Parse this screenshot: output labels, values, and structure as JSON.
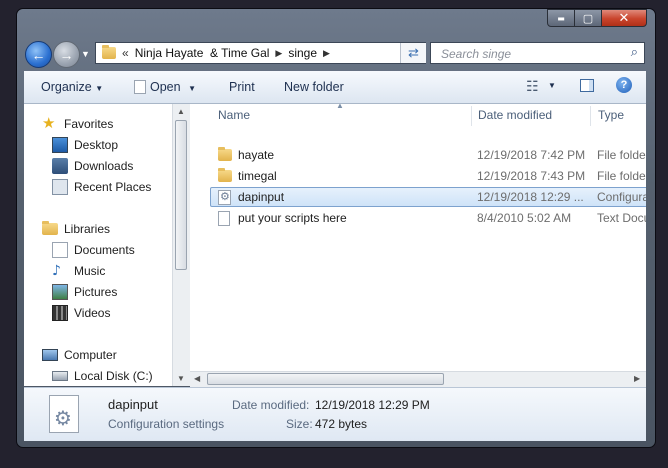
{
  "window": {
    "caption_buttons": {
      "minimize": "▬",
      "maximize": "▢",
      "close": "✕"
    }
  },
  "address": {
    "overflow": "«",
    "segments": [
      "Ninja Hayate  & Time Gal",
      "singe"
    ],
    "refresh_icon": "refresh-icon"
  },
  "search": {
    "placeholder": "Search singe"
  },
  "toolbar": {
    "organize": "Organize",
    "open": "Open",
    "print": "Print",
    "new_folder": "New folder"
  },
  "nav_pane": {
    "groups": [
      {
        "label": "Favorites",
        "icon": "star-icon",
        "items": [
          {
            "label": "Desktop",
            "icon": "desktop-icon"
          },
          {
            "label": "Downloads",
            "icon": "downloads-icon"
          },
          {
            "label": "Recent Places",
            "icon": "recent-places-icon"
          }
        ]
      },
      {
        "label": "Libraries",
        "icon": "libraries-icon",
        "items": [
          {
            "label": "Documents",
            "icon": "documents-icon"
          },
          {
            "label": "Music",
            "icon": "music-icon"
          },
          {
            "label": "Pictures",
            "icon": "pictures-icon"
          },
          {
            "label": "Videos",
            "icon": "videos-icon"
          }
        ]
      },
      {
        "label": "Computer",
        "icon": "computer-icon",
        "items": [
          {
            "label": "Local Disk (C:)",
            "icon": "local-disk-icon"
          }
        ]
      }
    ]
  },
  "files": {
    "columns": [
      "Name",
      "Date modified",
      "Type"
    ],
    "rows": [
      {
        "name": "hayate",
        "date": "12/19/2018 7:42 PM",
        "type": "File folder",
        "icon": "folder-icon"
      },
      {
        "name": "timegal",
        "date": "12/19/2018 7:43 PM",
        "type": "File folder",
        "icon": "folder-icon"
      },
      {
        "name": "dapinput",
        "date": "12/19/2018 12:29 ...",
        "type": "Configuration",
        "icon": "config-file-icon",
        "selected": true
      },
      {
        "name": "put your scripts here",
        "date": "8/4/2010 5:02 AM",
        "type": "Text Docume",
        "icon": "text-file-icon"
      }
    ]
  },
  "details": {
    "name": "dapinput",
    "kind": "Configuration settings",
    "date_label": "Date modified:",
    "date_value": "12/19/2018 12:29 PM",
    "size_label": "Size:",
    "size_value": "472 bytes"
  },
  "colors": {
    "accent": "#3a6fb0",
    "selection": "#cfe3f8",
    "frame": "#56616f"
  }
}
